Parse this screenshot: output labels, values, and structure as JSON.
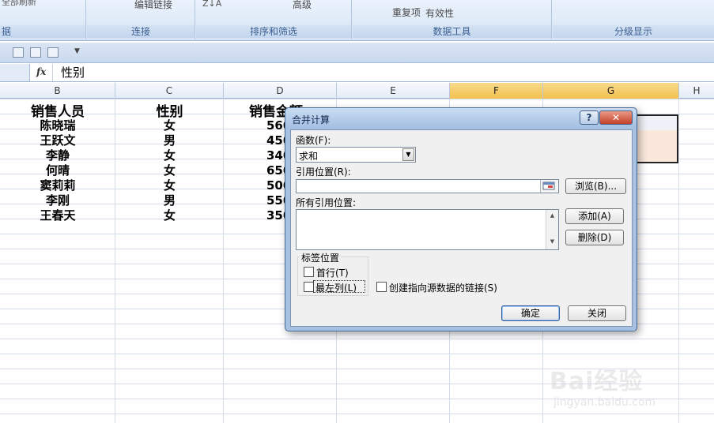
{
  "ribbon": {
    "groups": [
      {
        "label": "据"
      },
      {
        "label": "连接"
      },
      {
        "label": "排序和筛选"
      },
      {
        "label": "数据工具"
      },
      {
        "label": "分级显示"
      }
    ],
    "edit_links": "编辑链接",
    "advanced": "高级",
    "remove_dup": "重复项",
    "validity": "有效性"
  },
  "formula_bar": {
    "fx": "fx",
    "content": "性别"
  },
  "columns": [
    "B",
    "C",
    "D",
    "E",
    "F",
    "G",
    "H"
  ],
  "sheet": {
    "headers": {
      "b": "销售人员",
      "c": "性别",
      "d": "销售金额"
    },
    "rows": [
      {
        "name": "陈晓瑞",
        "gender": "女",
        "amount": "560"
      },
      {
        "name": "王跃文",
        "gender": "男",
        "amount": "450"
      },
      {
        "name": "李静",
        "gender": "女",
        "amount": "340"
      },
      {
        "name": "何晴",
        "gender": "女",
        "amount": "650"
      },
      {
        "name": "窦莉莉",
        "gender": "女",
        "amount": "500"
      },
      {
        "name": "李刚",
        "gender": "男",
        "amount": "550"
      },
      {
        "name": "王春天",
        "gender": "女",
        "amount": "350"
      }
    ]
  },
  "dialog": {
    "title": "合并计算",
    "help": "?",
    "function_label": "函数(F):",
    "function_value": "求和",
    "ref_label": "引用位置(R):",
    "browse": "浏览(B)...",
    "all_refs_label": "所有引用位置:",
    "add": "添加(A)",
    "delete": "删除(D)",
    "label_position": "标签位置",
    "first_row": "首行(T)",
    "left_column": "最左列(L)",
    "create_links": "创建指向源数据的链接(S)",
    "ok": "确定",
    "close": "关闭"
  },
  "watermark": {
    "brand": "Bai经验",
    "url": "jingyan.baidu.com"
  }
}
